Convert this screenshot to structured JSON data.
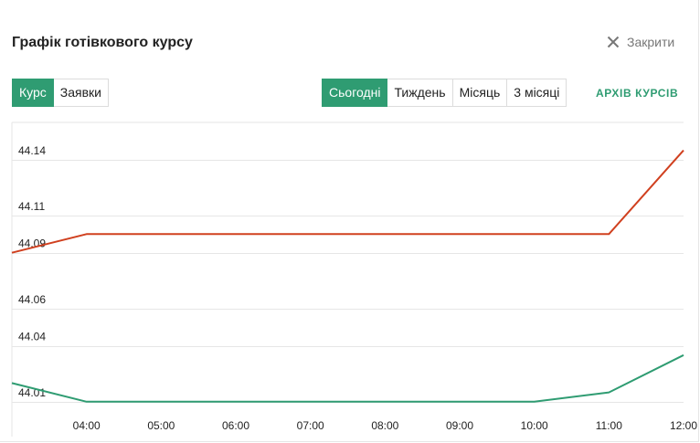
{
  "header": {
    "title": "Графік готівкового курсу",
    "close_label": "Закрити"
  },
  "mode_tabs": [
    {
      "label": "Курс",
      "active": true
    },
    {
      "label": "Заявки",
      "active": false
    }
  ],
  "period_tabs": [
    {
      "label": "Сьогодні",
      "active": true
    },
    {
      "label": "Тиждень",
      "active": false
    },
    {
      "label": "Місяць",
      "active": false
    },
    {
      "label": "3 місяці",
      "active": false
    }
  ],
  "archive_link": "АРХІВ КУРСІВ",
  "colors": {
    "accent": "#2f9c72",
    "sell_line": "#d0401f",
    "buy_line": "#2f9c72",
    "grid": "#e6e6e6"
  },
  "chart_data": {
    "type": "line",
    "x": [
      "03:00",
      "04:00",
      "05:00",
      "06:00",
      "07:00",
      "08:00",
      "09:00",
      "10:00",
      "11:00",
      "12:00"
    ],
    "x_tick_labels": [
      "04:00",
      "05:00",
      "06:00",
      "07:00",
      "08:00",
      "09:00",
      "10:00",
      "11:00",
      "12:00"
    ],
    "y_tick_labels": [
      "44.14",
      "44.11",
      "44.09",
      "44.06",
      "44.04",
      "44.01"
    ],
    "y_ticks": [
      44.14,
      44.11,
      44.09,
      44.06,
      44.04,
      44.01
    ],
    "series": [
      {
        "color": "#d0401f",
        "values": [
          44.09,
          44.1,
          44.1,
          44.1,
          44.1,
          44.1,
          44.1,
          44.1,
          44.1,
          44.145
        ]
      },
      {
        "color": "#2f9c72",
        "values": [
          44.02,
          44.01,
          44.01,
          44.01,
          44.01,
          44.01,
          44.01,
          44.01,
          44.015,
          44.035
        ]
      }
    ],
    "ylim": [
      44.005,
      44.16
    ],
    "grid": true,
    "legend": "none"
  }
}
